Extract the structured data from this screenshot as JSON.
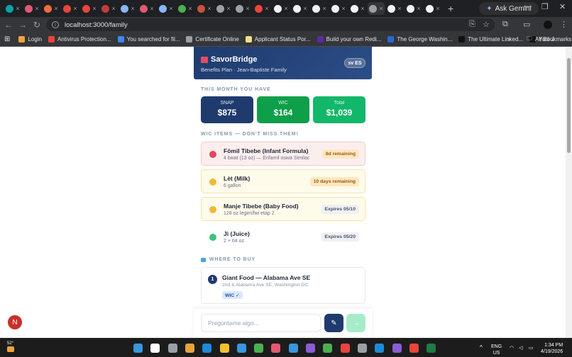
{
  "browser": {
    "url": "localhost:3000/family",
    "gemini_label": "Ask Gemini",
    "tab_colors": [
      "#0aa5a6",
      "#e05a72",
      "#f26b3a",
      "#e8453c",
      "#e8453c",
      "#c23b3b",
      "#8ab4f8",
      "#e05a72",
      "#8ab4f8",
      "#4caf50",
      "#c5553c",
      "#9aa0a6",
      "#9aa0a6",
      "#e8453c",
      "#f1f3f4",
      "#f1f3f4",
      "#f1f3f4",
      "#f1f3f4",
      "#f1f3f4",
      "#9aa0a6",
      "#f1f3f4",
      "#f1f3f4",
      "#f1f3f4"
    ],
    "bookmarks": [
      {
        "label": "Login",
        "color": "#f2a33a"
      },
      {
        "label": "Antivirus Protection...",
        "color": "#e8453c"
      },
      {
        "label": "You searched for fil...",
        "color": "#4285f4"
      },
      {
        "label": "Certificate Online",
        "color": "#9aa0a6"
      },
      {
        "label": "Applicant Status Por...",
        "color": "#f1e08a"
      },
      {
        "label": "Build your own Redi...",
        "color": "#5a2ca0"
      },
      {
        "label": "The George Washin...",
        "color": "#2b67d1"
      },
      {
        "label": "The Ultimate Linked...",
        "color": "#111111"
      },
      {
        "label": "Yudi J",
        "color": "#111111"
      }
    ],
    "all_bookmarks": "All Bookmarks"
  },
  "app": {
    "brand": "SavorBridge",
    "subtitle": "Benefits Plan · Jean-Baptiste Family",
    "lang_toggle": "sv ES",
    "month_heading": "THIS MONTH YOU HAVE",
    "balances": [
      {
        "label": "SNAP",
        "value": "$875",
        "color": "#1f3b6e"
      },
      {
        "label": "WIC",
        "value": "$164",
        "color": "#0e9f4a"
      },
      {
        "label": "Total",
        "value": "$1,039",
        "color": "#12b76a"
      }
    ],
    "wic_heading": "WIC ITEMS — DON'T MISS THEM!",
    "wic_items": [
      {
        "title": "Fòmil Tibebe (Infant Formula)",
        "detail": "4 bwat (13 oz) — Enfamil oswa Similac",
        "badge": "8d remaining",
        "bg": "#fdeeee",
        "border": "#f6c9c9",
        "dot": "#e0475b",
        "badge_bg": "#fde7c3",
        "badge_fg": "#9a5b00"
      },
      {
        "title": "Lèt (Milk)",
        "detail": "6 gallon",
        "badge": "10 days remaining",
        "bg": "#fffbea",
        "border": "#f6e3a6",
        "dot": "#f0b93a",
        "badge_bg": "#fde7c3",
        "badge_fg": "#9a5b00"
      },
      {
        "title": "Manje Tibebe (Baby Food)",
        "detail": "128 oz legim/fwi etap 2",
        "badge": "Expires 05/10",
        "bg": "#fffbea",
        "border": "#f6e3a6",
        "dot": "#f0b93a",
        "badge_bg": "#eef0f4",
        "badge_fg": "#475467"
      },
      {
        "title": "Ji (Juice)",
        "detail": "2 × 64 oz",
        "badge": "Expires 05/20",
        "bg": "#ffffff",
        "border": "#ffffff",
        "dot": "#3cc47c",
        "badge_bg": "#eef0f4",
        "badge_fg": "#475467"
      }
    ],
    "where_heading": "WHERE TO BUY",
    "store": {
      "index": "1",
      "name": "Giant Food — Alabama Ave SE",
      "address": "2nd & Alabama Ave SE, Washington DC",
      "tag": "WIC ✓"
    },
    "chat_placeholder": "Pregúntame algo...",
    "avatar_letter": "N"
  },
  "taskbar": {
    "weather": "52°",
    "lang": "ENG",
    "region": "US",
    "time": "1:34 PM",
    "date": "4/19/2026",
    "icons": [
      "#3a96dd",
      "#ffffff",
      "#9aa0a6",
      "#e8a23a",
      "#1f8ad8",
      "#f2c12e",
      "#3a96dd",
      "#4caf50",
      "#e05a72",
      "#3a96dd",
      "#8a5cd6",
      "#4caf50",
      "#e8453c",
      "#9aa0a6",
      "#1f8ad8",
      "#8a5cd6",
      "#e8453c",
      "#1e7b45"
    ]
  }
}
